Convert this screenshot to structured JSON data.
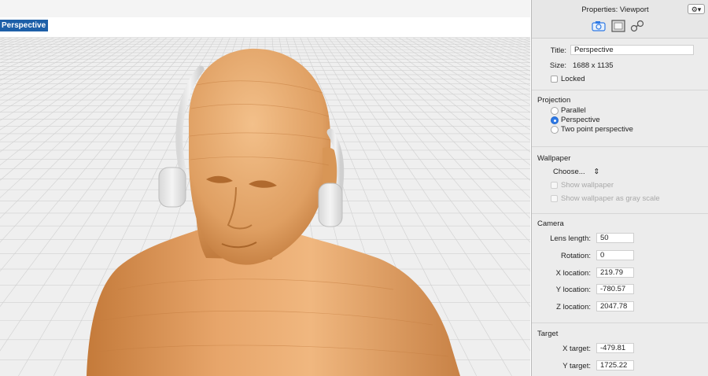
{
  "viewport": {
    "label": "Perspective",
    "grid_color": "#d0d0d0",
    "floor_color": "#efefef"
  },
  "panel": {
    "title": "Properties: Viewport",
    "tabs": [
      "camera-icon",
      "frame-icon",
      "link-icon"
    ],
    "general": {
      "title_label": "Title:",
      "title_value": "Perspective",
      "size_label": "Size:",
      "size_value": "1688 x 1135",
      "locked_label": "Locked"
    },
    "projection": {
      "heading": "Projection",
      "options": [
        "Parallel",
        "Perspective",
        "Two point perspective"
      ],
      "selected": "Perspective"
    },
    "wallpaper": {
      "heading": "Wallpaper",
      "choose_label": "Choose...",
      "show_wallpaper": "Show wallpaper",
      "show_gray": "Show wallpaper as gray scale"
    },
    "camera": {
      "heading": "Camera",
      "lens_label": "Lens length:",
      "lens_value": "50",
      "rotation_label": "Rotation:",
      "rotation_value": "0",
      "x_label": "X location:",
      "x_value": "219.79",
      "y_label": "Y location:",
      "y_value": "-780.57",
      "z_label": "Z location:",
      "z_value": "2047.78"
    },
    "target": {
      "heading": "Target",
      "x_label": "X target:",
      "x_value": "-479.81",
      "y_label": "Y target:",
      "y_value": "1725.22"
    },
    "accent": "#2f7ae5"
  }
}
